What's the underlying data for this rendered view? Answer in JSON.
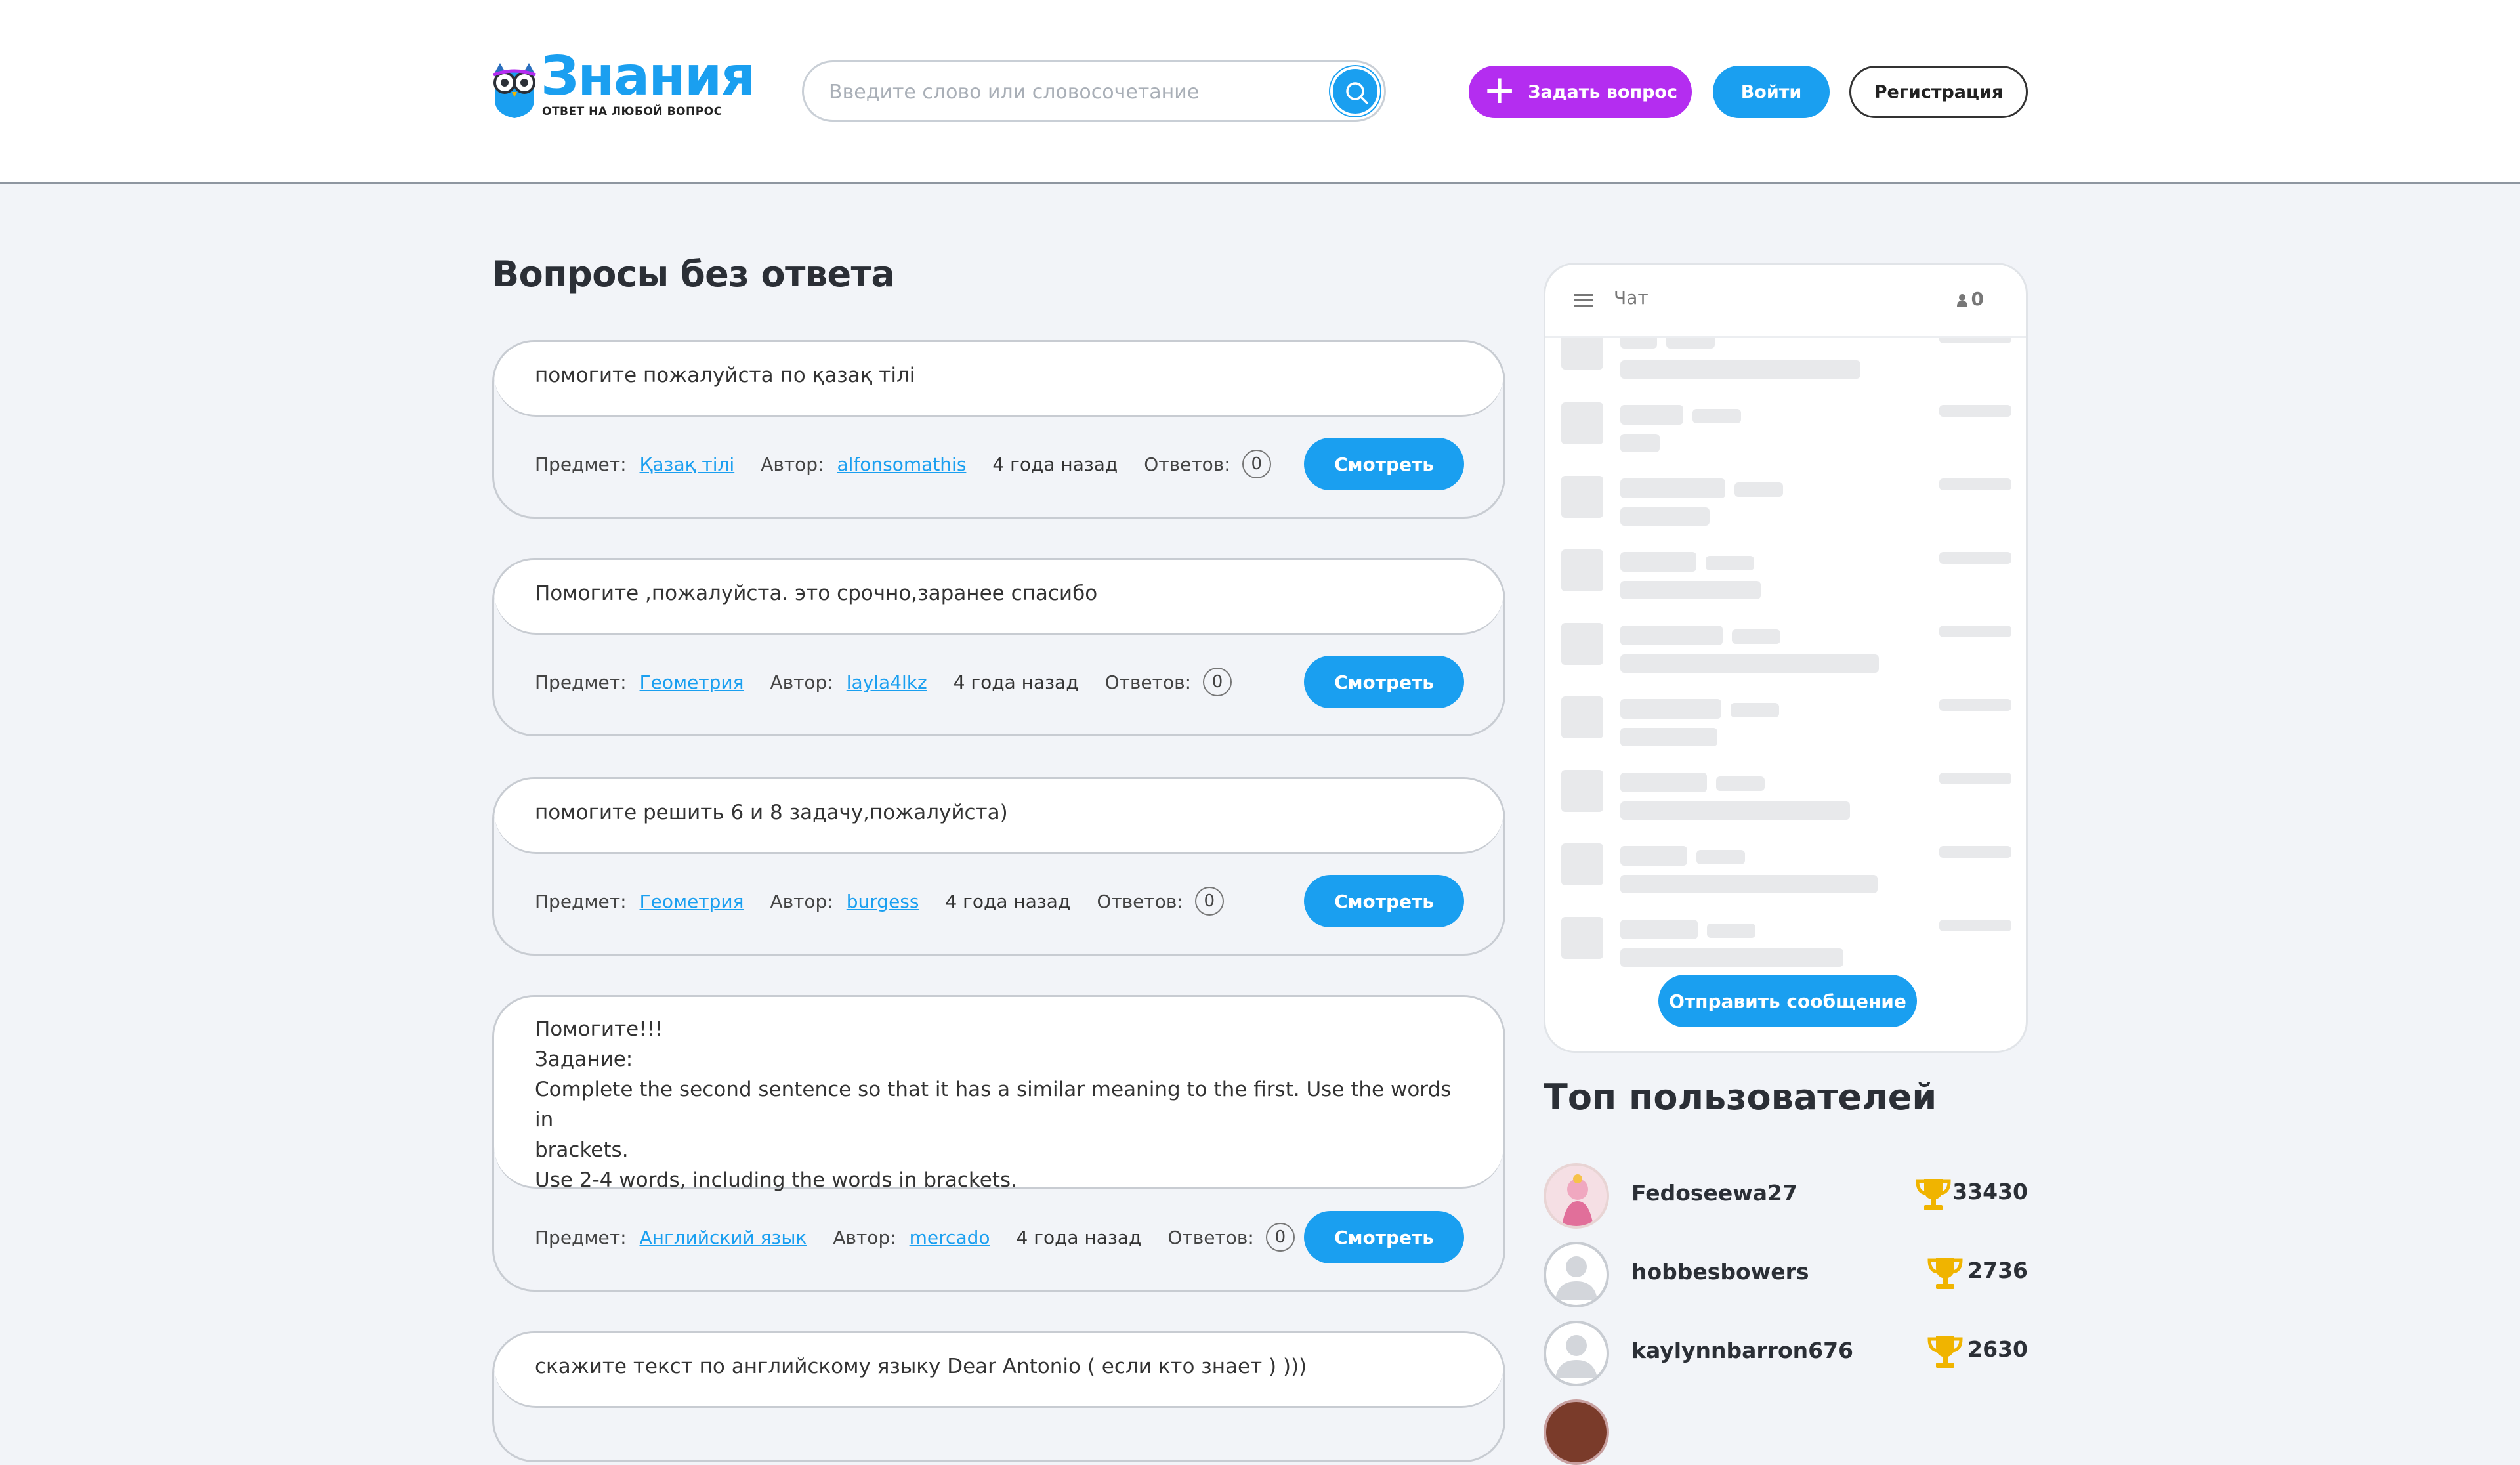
{
  "header": {
    "logo_title": "Знания",
    "logo_subtitle": "ОТВЕТ НА ЛЮБОЙ ВОПРОС",
    "search_placeholder": "Введите слово или словосочетание",
    "ask_label": "Задать вопрос",
    "login_label": "Войти",
    "register_label": "Регистрация"
  },
  "main": {
    "title": "Вопросы без ответа",
    "labels": {
      "subject": "Предмет:",
      "author": "Автор:",
      "answers": "Ответов:",
      "view": "Смотреть"
    },
    "questions": [
      {
        "text": "помогите пожалуйста по қазақ тілі",
        "subject": "Қазақ тілі",
        "author": "alfonsomathis",
        "time": "4 года назад",
        "answers": "0"
      },
      {
        "text": "Помогите ,пожалуйста. это срочно,заранее спасибо",
        "subject": "Геометрия",
        "author": "layla4lkz",
        "time": "4 года назад",
        "answers": "0"
      },
      {
        "text": "помогите решить 6 и 8 задачу,пожалуйста)",
        "subject": "Геометрия",
        "author": "burgess",
        "time": "4 года назад",
        "answers": "0"
      },
      {
        "lines": [
          "Помогите!!!",
          "Задание:",
          "Complete the second sentence so that it has a similar meaning to the first. Use the words in",
          "brackets.",
          "Use 2-4 words, including the words in brackets."
        ],
        "subject": "Английский язык",
        "author": "mercado",
        "time": "4 года назад",
        "answers": "0"
      },
      {
        "text": "скажите текст по английскому языку Dear Antonio ( если кто знает ) )))"
      }
    ]
  },
  "chat": {
    "title": "Чат",
    "users_count": "0",
    "send_label": "Отправить сообщение"
  },
  "top_users": {
    "title": "Топ пользователей",
    "users": [
      {
        "name": "Fedoseewa27",
        "score": "33430"
      },
      {
        "name": "hobbesbowers",
        "score": "2736"
      },
      {
        "name": "kaylynnbarron676",
        "score": "2630"
      }
    ]
  },
  "colors": {
    "accent_blue": "#1a9ff0",
    "accent_purple": "#b42df0",
    "trophy": "#f0b400"
  }
}
